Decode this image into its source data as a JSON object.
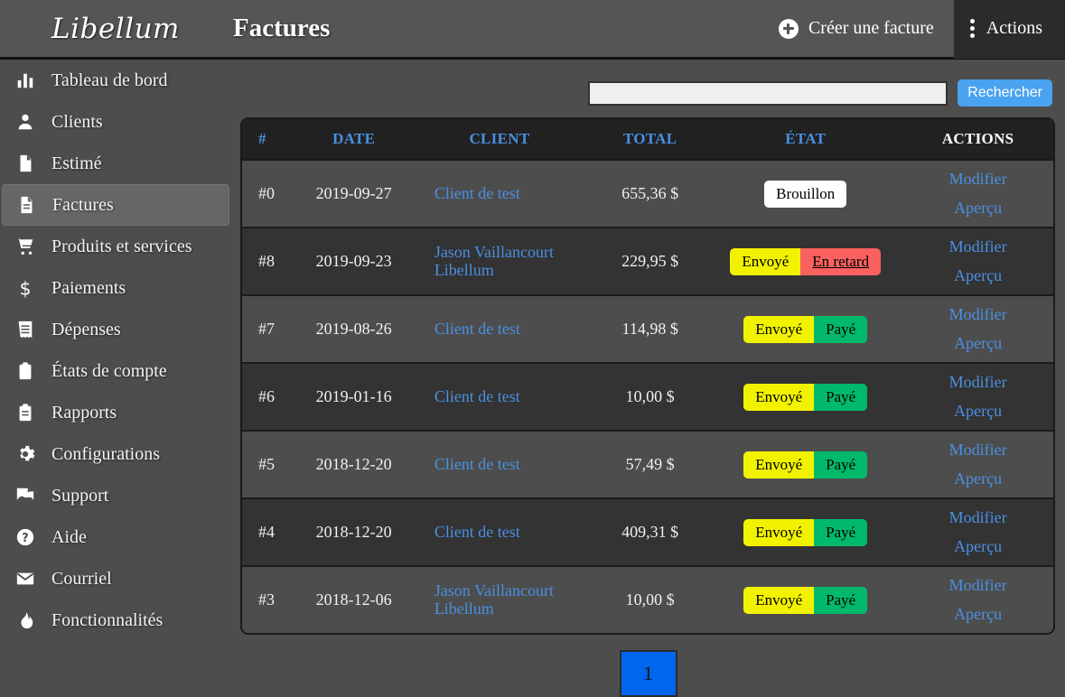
{
  "topbar": {
    "logo": "Libellum",
    "page_title": "Factures",
    "create_label": "Créer une facture",
    "create_icon": "plus-circle-icon",
    "actions_label": "Actions",
    "actions_icon": "more-vertical-icon",
    "actions_bg": "#2b2b2b",
    "bg": "#555555"
  },
  "sidebar": {
    "items": [
      {
        "label": "Tableau de bord",
        "icon": "bar-chart-icon",
        "active": false
      },
      {
        "label": "Clients",
        "icon": "person-icon",
        "active": false
      },
      {
        "label": "Estimé",
        "icon": "document-icon",
        "active": false
      },
      {
        "label": "Factures",
        "icon": "invoice-document-icon",
        "active": true
      },
      {
        "label": "Produits et services",
        "icon": "shopping-cart-icon",
        "active": false
      },
      {
        "label": "Paiements",
        "icon": "dollar-sign-icon",
        "active": false
      },
      {
        "label": "Dépenses",
        "icon": "receipt-icon",
        "active": false
      },
      {
        "label": "États de compte",
        "icon": "clipboard-icon",
        "active": false
      },
      {
        "label": "Rapports",
        "icon": "clipboard-lines-icon",
        "active": false
      },
      {
        "label": "Configurations",
        "icon": "gear-icon",
        "active": false
      },
      {
        "label": "Support",
        "icon": "chat-forum-icon",
        "active": false
      },
      {
        "label": "Aide",
        "icon": "help-circle-icon",
        "active": false
      },
      {
        "label": "Courriel",
        "icon": "envelope-icon",
        "active": false
      },
      {
        "label": "Fonctionnalités",
        "icon": "fire-icon",
        "active": false
      }
    ]
  },
  "search": {
    "value": "",
    "placeholder": "",
    "button_label": "Rechercher",
    "button_color": "#4aa3f0"
  },
  "table": {
    "headers": [
      {
        "label": "#",
        "link": true
      },
      {
        "label": "DATE",
        "link": true
      },
      {
        "label": "CLIENT",
        "link": true
      },
      {
        "label": "TOTAL",
        "link": true
      },
      {
        "label": "ÉTAT",
        "link": true
      },
      {
        "label": "ACTIONS",
        "link": false
      }
    ],
    "header_bg": "#212121",
    "header_link_color": "#4a90e2",
    "rows": [
      {
        "id": "#0",
        "date": "2019-09-27",
        "client": "Client de test",
        "total": "655,36 $",
        "badges": [
          {
            "label": "Brouillon",
            "kind": "draft"
          }
        ],
        "actions": [
          "Modifier",
          "Aperçu"
        ]
      },
      {
        "id": "#8",
        "date": "2019-09-23",
        "client": "Jason Vaillancourt Libellum",
        "total": "229,95 $",
        "badges": [
          {
            "label": "Envoyé",
            "kind": "sent"
          },
          {
            "label": "En retard",
            "kind": "late"
          }
        ],
        "actions": [
          "Modifier",
          "Aperçu"
        ]
      },
      {
        "id": "#7",
        "date": "2019-08-26",
        "client": "Client de test",
        "total": "114,98 $",
        "badges": [
          {
            "label": "Envoyé",
            "kind": "sent"
          },
          {
            "label": "Payé",
            "kind": "paid"
          }
        ],
        "actions": [
          "Modifier",
          "Aperçu"
        ]
      },
      {
        "id": "#6",
        "date": "2019-01-16",
        "client": "Client de test",
        "total": "10,00 $",
        "badges": [
          {
            "label": "Envoyé",
            "kind": "sent"
          },
          {
            "label": "Payé",
            "kind": "paid"
          }
        ],
        "actions": [
          "Modifier",
          "Aperçu"
        ]
      },
      {
        "id": "#5",
        "date": "2018-12-20",
        "client": "Client de test",
        "total": "57,49 $",
        "badges": [
          {
            "label": "Envoyé",
            "kind": "sent"
          },
          {
            "label": "Payé",
            "kind": "paid"
          }
        ],
        "actions": [
          "Modifier",
          "Aperçu"
        ]
      },
      {
        "id": "#4",
        "date": "2018-12-20",
        "client": "Client de test",
        "total": "409,31 $",
        "badges": [
          {
            "label": "Envoyé",
            "kind": "sent"
          },
          {
            "label": "Payé",
            "kind": "paid"
          }
        ],
        "actions": [
          "Modifier",
          "Aperçu"
        ]
      },
      {
        "id": "#3",
        "date": "2018-12-06",
        "client": "Jason Vaillancourt Libellum",
        "total": "10,00 $",
        "badges": [
          {
            "label": "Envoyé",
            "kind": "sent"
          },
          {
            "label": "Payé",
            "kind": "paid"
          }
        ],
        "actions": [
          "Modifier",
          "Aperçu"
        ]
      }
    ]
  },
  "pagination": {
    "pages": [
      "1"
    ],
    "current": "1",
    "active_color": "#0066ee"
  },
  "colors": {
    "page_bg": "#4d4d4d",
    "row_alt_bg": "#333333",
    "badge_sent": "#f2f200",
    "badge_paid": "#00b96a",
    "badge_late": "#f9615f",
    "badge_draft": "#ffffff"
  }
}
